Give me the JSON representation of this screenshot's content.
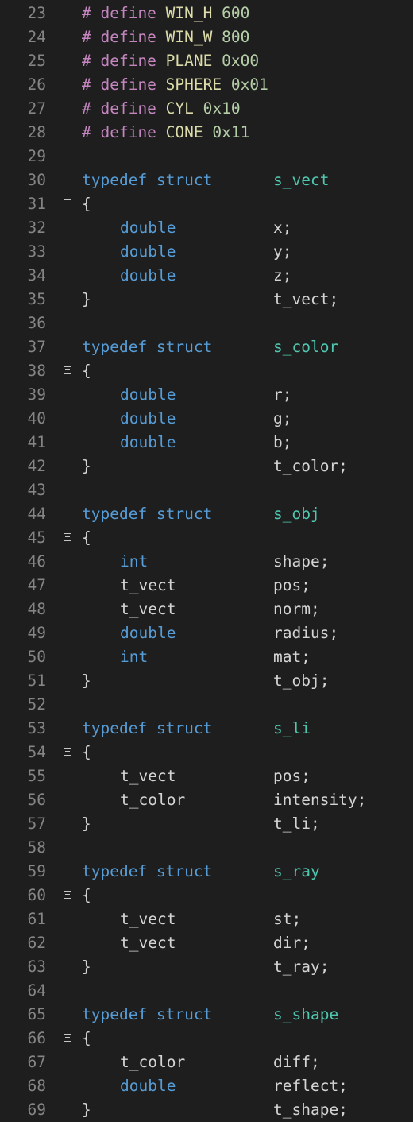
{
  "theme": {
    "background": "#1e1e1e",
    "line_number": "#858585",
    "directive": "#c586c0",
    "macro": "#dcdcaa",
    "number": "#b5cea8",
    "keyword": "#569cd6",
    "struct_tag": "#4ec9b0",
    "text": "#d4d4d4",
    "fold_icon": "collapse-icon"
  },
  "lines": [
    {
      "n": "23",
      "kind": "define",
      "a": "# define",
      "b": "WIN_H",
      "c": "600"
    },
    {
      "n": "24",
      "kind": "define",
      "a": "# define",
      "b": "WIN_W",
      "c": "800"
    },
    {
      "n": "25",
      "kind": "define",
      "a": "# define",
      "b": "PLANE",
      "c": "0x00"
    },
    {
      "n": "26",
      "kind": "define",
      "a": "# define",
      "b": "SPHERE",
      "c": "0x01"
    },
    {
      "n": "27",
      "kind": "define",
      "a": "# define",
      "b": "CYL",
      "c": "0x10"
    },
    {
      "n": "28",
      "kind": "define",
      "a": "# define",
      "b": "CONE",
      "c": "0x11"
    },
    {
      "n": "29",
      "kind": "blank"
    },
    {
      "n": "30",
      "kind": "typedef",
      "a": "typedef struct",
      "c": "s_vect"
    },
    {
      "n": "31",
      "kind": "open",
      "a": "{"
    },
    {
      "n": "32",
      "kind": "member",
      "a": "double",
      "kw": true,
      "c": "x;"
    },
    {
      "n": "33",
      "kind": "member",
      "a": "double",
      "kw": true,
      "c": "y;"
    },
    {
      "n": "34",
      "kind": "member",
      "a": "double",
      "kw": true,
      "c": "z;"
    },
    {
      "n": "35",
      "kind": "close",
      "a": "}",
      "c": "t_vect;"
    },
    {
      "n": "36",
      "kind": "blank"
    },
    {
      "n": "37",
      "kind": "typedef",
      "a": "typedef struct",
      "c": "s_color"
    },
    {
      "n": "38",
      "kind": "open",
      "a": "{"
    },
    {
      "n": "39",
      "kind": "member",
      "a": "double",
      "kw": true,
      "c": "r;"
    },
    {
      "n": "40",
      "kind": "member",
      "a": "double",
      "kw": true,
      "c": "g;"
    },
    {
      "n": "41",
      "kind": "member",
      "a": "double",
      "kw": true,
      "c": "b;"
    },
    {
      "n": "42",
      "kind": "close",
      "a": "}",
      "c": "t_color;"
    },
    {
      "n": "43",
      "kind": "blank"
    },
    {
      "n": "44",
      "kind": "typedef",
      "a": "typedef struct",
      "c": "s_obj"
    },
    {
      "n": "45",
      "kind": "open",
      "a": "{"
    },
    {
      "n": "46",
      "kind": "member",
      "a": "int",
      "kw": true,
      "c": "shape;"
    },
    {
      "n": "47",
      "kind": "member",
      "a": "t_vect",
      "kw": false,
      "c": "pos;"
    },
    {
      "n": "48",
      "kind": "member",
      "a": "t_vect",
      "kw": false,
      "c": "norm;"
    },
    {
      "n": "49",
      "kind": "member",
      "a": "double",
      "kw": true,
      "c": "radius;"
    },
    {
      "n": "50",
      "kind": "member",
      "a": "int",
      "kw": true,
      "c": "mat;"
    },
    {
      "n": "51",
      "kind": "close",
      "a": "}",
      "c": "t_obj;"
    },
    {
      "n": "52",
      "kind": "blank"
    },
    {
      "n": "53",
      "kind": "typedef",
      "a": "typedef struct",
      "c": "s_li"
    },
    {
      "n": "54",
      "kind": "open",
      "a": "{"
    },
    {
      "n": "55",
      "kind": "member",
      "a": "t_vect",
      "kw": false,
      "c": "pos;"
    },
    {
      "n": "56",
      "kind": "member",
      "a": "t_color",
      "kw": false,
      "c": "intensity;"
    },
    {
      "n": "57",
      "kind": "close",
      "a": "}",
      "c": "t_li;"
    },
    {
      "n": "58",
      "kind": "blank"
    },
    {
      "n": "59",
      "kind": "typedef",
      "a": "typedef struct",
      "c": "s_ray"
    },
    {
      "n": "60",
      "kind": "open",
      "a": "{"
    },
    {
      "n": "61",
      "kind": "member",
      "a": "t_vect",
      "kw": false,
      "c": "st;"
    },
    {
      "n": "62",
      "kind": "member",
      "a": "t_vect",
      "kw": false,
      "c": "dir;"
    },
    {
      "n": "63",
      "kind": "close",
      "a": "}",
      "c": "t_ray;"
    },
    {
      "n": "64",
      "kind": "blank"
    },
    {
      "n": "65",
      "kind": "typedef",
      "a": "typedef struct",
      "c": "s_shape"
    },
    {
      "n": "66",
      "kind": "open",
      "a": "{"
    },
    {
      "n": "67",
      "kind": "member",
      "a": "t_color",
      "kw": false,
      "c": "diff;"
    },
    {
      "n": "68",
      "kind": "member",
      "a": "double",
      "kw": true,
      "c": "reflect;"
    },
    {
      "n": "69",
      "kind": "close",
      "a": "}",
      "c": "t_shape;"
    }
  ]
}
